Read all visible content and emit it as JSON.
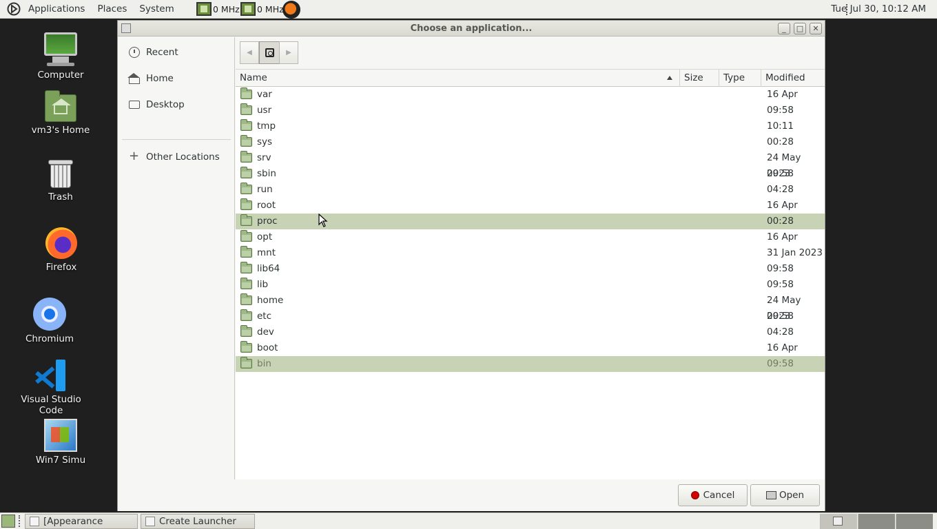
{
  "top_panel": {
    "menus": [
      "Applications",
      "Places",
      "System"
    ],
    "cpu": [
      "0 MHz",
      "0 MHz"
    ],
    "clock": "Tue Jul 30, 10:12 AM"
  },
  "desktop_icons": [
    {
      "label": "Computer",
      "icon": "computer-icon"
    },
    {
      "label": "vm3's Home",
      "icon": "home-folder-icon"
    },
    {
      "label": "Trash",
      "icon": "trash-icon"
    },
    {
      "label": "Firefox",
      "icon": "firefox-icon"
    },
    {
      "label": "Chromium",
      "icon": "chromium-icon"
    },
    {
      "label": "Visual Studio Code",
      "icon": "vscode-icon"
    },
    {
      "label": "Win7 Simu",
      "icon": "win7-icon"
    }
  ],
  "dialog": {
    "title": "Choose an application...",
    "sidebar": {
      "items": [
        {
          "label": "Recent",
          "icon": "clock-icon"
        },
        {
          "label": "Home",
          "icon": "home-icon"
        },
        {
          "label": "Desktop",
          "icon": "desktop-icon"
        },
        {
          "label": "Other Locations",
          "icon": "plus-icon"
        }
      ]
    },
    "columns": {
      "name": "Name",
      "size": "Size",
      "type": "Type",
      "modified": "Modified"
    },
    "files": [
      {
        "name": "var",
        "modified": "16 Apr"
      },
      {
        "name": "usr",
        "modified": "09:58"
      },
      {
        "name": "tmp",
        "modified": "10:11"
      },
      {
        "name": "sys",
        "modified": "00:28"
      },
      {
        "name": "srv",
        "modified": "24 May 2023"
      },
      {
        "name": "sbin",
        "modified": "09:58"
      },
      {
        "name": "run",
        "modified": "04:28"
      },
      {
        "name": "root",
        "modified": "16 Apr"
      },
      {
        "name": "proc",
        "modified": "00:28"
      },
      {
        "name": "opt",
        "modified": "16 Apr"
      },
      {
        "name": "mnt",
        "modified": "31 Jan 2023"
      },
      {
        "name": "lib64",
        "modified": "09:58"
      },
      {
        "name": "lib",
        "modified": "09:58"
      },
      {
        "name": "home",
        "modified": "24 May 2023"
      },
      {
        "name": "etc",
        "modified": "09:58"
      },
      {
        "name": "dev",
        "modified": "04:28"
      },
      {
        "name": "boot",
        "modified": "16 Apr"
      },
      {
        "name": "bin",
        "modified": "09:58"
      }
    ],
    "highlighted_rows": [
      "proc",
      "bin"
    ],
    "buttons": {
      "cancel": "Cancel",
      "open": "Open"
    }
  },
  "taskbar": {
    "tasks": [
      "[Appearance Prefer...",
      "Create Launcher"
    ]
  },
  "colors": {
    "row_highlight": "#c8d2b4",
    "folder": "#9fb888",
    "cancel_icon": "#d40000"
  }
}
